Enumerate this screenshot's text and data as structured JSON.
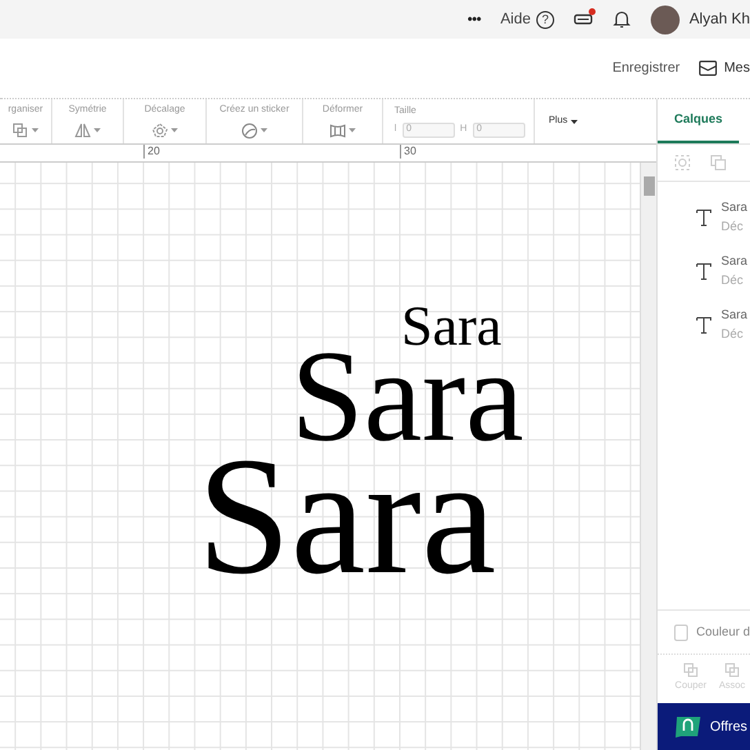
{
  "top_bar": {
    "more": "•••",
    "help": "Aide",
    "help_icon": "?",
    "user": "Alyah Kh",
    "notification_dot": true
  },
  "header": {
    "save": "Enregistrer",
    "projects": "Mes"
  },
  "toolbar": {
    "groups": [
      {
        "label": "rganiser"
      },
      {
        "label": "Symétrie"
      },
      {
        "label": "Décalage"
      },
      {
        "label": "Créez un sticker"
      },
      {
        "label": "Déformer"
      }
    ],
    "size": {
      "label": "Taille",
      "width_label": "l",
      "width_value": "0",
      "height_label": "H",
      "height_value": "0"
    },
    "more": "Plus"
  },
  "ruler": {
    "ticks": [
      "20",
      "30"
    ]
  },
  "canvas": {
    "texts": [
      {
        "text": "Sara"
      },
      {
        "text": "Sara"
      },
      {
        "text": "Sara"
      }
    ]
  },
  "panel": {
    "tabs": [
      {
        "label": "Calques",
        "selected": true
      }
    ],
    "layers": [
      {
        "name": "Sara",
        "subtitle": "Déc"
      },
      {
        "name": "Sara",
        "subtitle": "Déc"
      },
      {
        "name": "Sara",
        "subtitle": "Déc"
      }
    ],
    "color_sync": {
      "label": "Couleur d",
      "checked": false
    },
    "actions": [
      "Couper",
      "Assoc"
    ],
    "offers": "Offres"
  }
}
